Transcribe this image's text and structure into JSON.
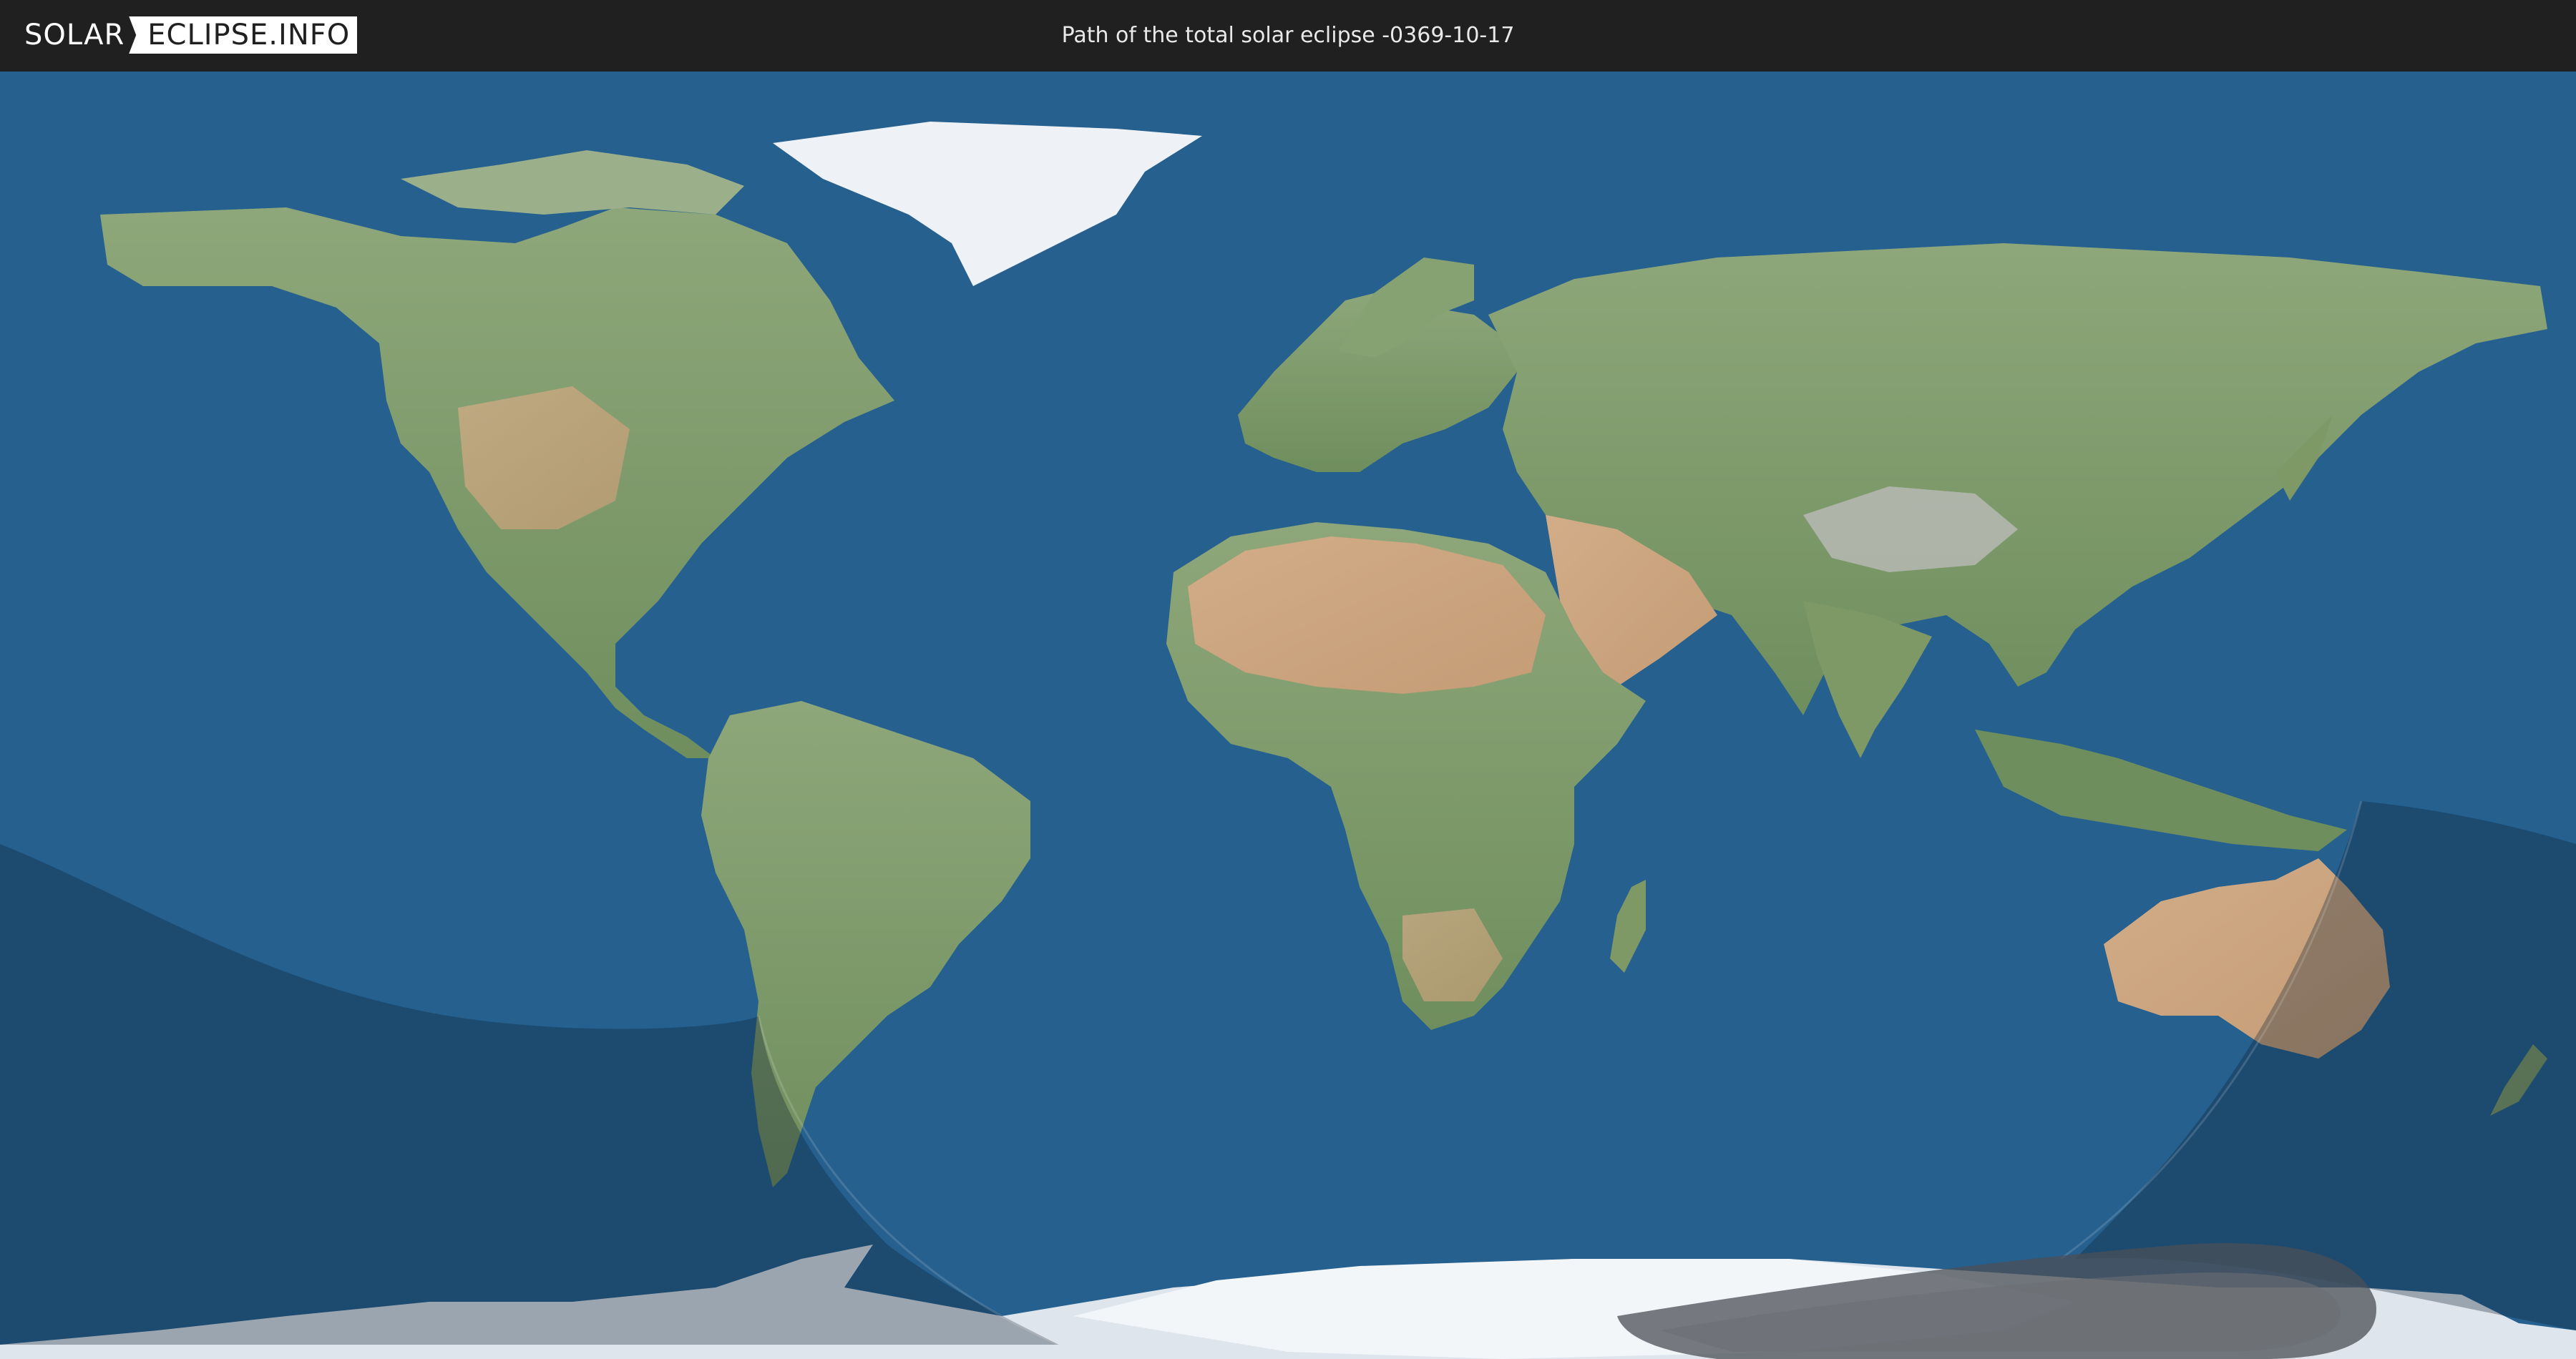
{
  "header": {
    "logo_part1": "SOLAR",
    "logo_part2": "ECLIPSE.INFO",
    "title": "Path of the total solar eclipse -0369-10-17"
  },
  "colors": {
    "header_bg": "#202020",
    "ocean": "#25608e",
    "land": "#7f9a6a",
    "desert": "#c9a27d",
    "ice": "#e9eef3",
    "penumbra_shade": "#0b1f33",
    "totality_path": "#5a5a5a"
  },
  "icons": {
    "logo_separator": "chevron-notch-icon"
  }
}
